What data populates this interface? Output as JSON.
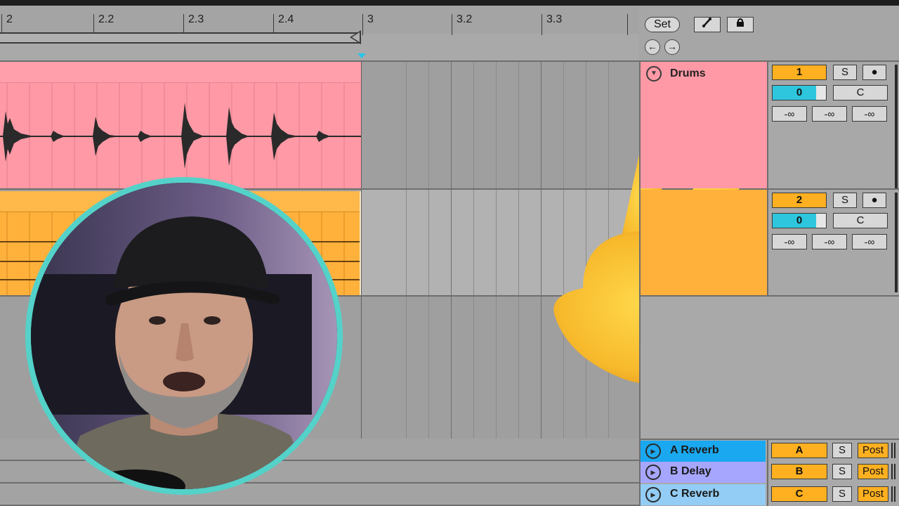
{
  "ruler": {
    "ticks": [
      "2",
      "2.2",
      "2.3",
      "2.4",
      "3",
      "3.2",
      "3.3"
    ]
  },
  "transport": {
    "set_label": "Set",
    "draw_icon": "pencil-draw-icon",
    "lock_icon": "lock-icon",
    "back_icon": "arrow-left-icon",
    "forward_icon": "arrow-right-icon"
  },
  "tracks": [
    {
      "name": "Drums",
      "color": "#ff99a6",
      "number": "1",
      "solo": "S",
      "volume": "0",
      "pan": "C",
      "sends": [
        "-∞",
        "-∞",
        "-∞"
      ]
    },
    {
      "name": "",
      "color": "#ffb13c",
      "number": "2",
      "solo": "S",
      "volume": "0",
      "pan": "C",
      "sends": [
        "-∞",
        "-∞",
        "-∞"
      ]
    }
  ],
  "returns": [
    {
      "name": "A Reverb",
      "letter": "A",
      "solo": "S",
      "mode": "Post",
      "color": "#1aa8f0"
    },
    {
      "name": "B Delay",
      "letter": "B",
      "solo": "S",
      "mode": "Post",
      "color": "#a7a6ff"
    },
    {
      "name": "C Reverb",
      "letter": "C",
      "solo": "S",
      "mode": "Post",
      "color": "#93cdf5"
    }
  ],
  "colors": {
    "accent_cyan": "#27c6e8",
    "track_number_orange": "#ffb020",
    "webcam_ring": "#54d2c9"
  }
}
